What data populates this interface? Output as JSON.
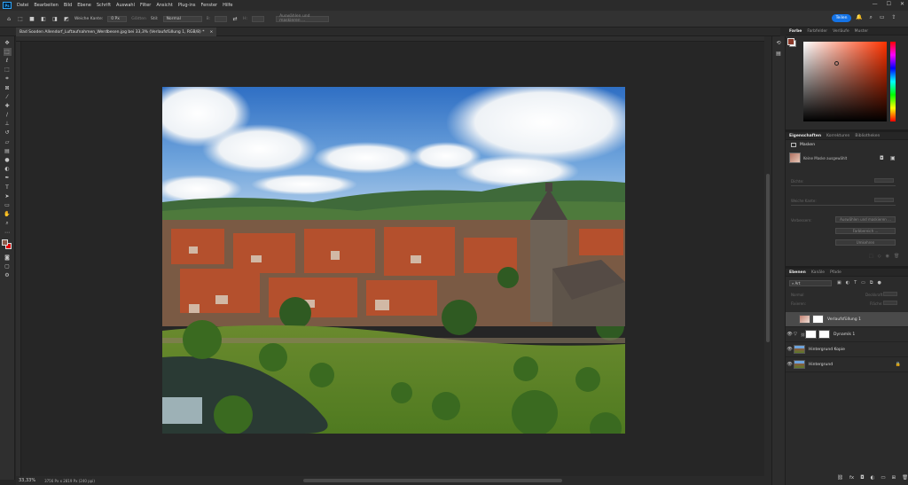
{
  "app": {
    "logo": "Ps"
  },
  "menu": [
    "Datei",
    "Bearbeiten",
    "Bild",
    "Ebene",
    "Schrift",
    "Auswahl",
    "Filter",
    "Ansicht",
    "Plug-ins",
    "Fenster",
    "Hilfe"
  ],
  "window_controls": {
    "minimize": "—",
    "maximize": "☐",
    "close": "✕"
  },
  "options": {
    "feather_label": "Weiche Kante:",
    "feather_value": "0 Px",
    "smooth_label": "Glätten",
    "style_label": "Stil:",
    "style_value": "Normal",
    "width_label": "B:",
    "height_label": "H:",
    "mask_button": "Auswählen und maskieren ..."
  },
  "share_label": "Teilen",
  "document": {
    "tab_title": "Bad Sooden Allendorf_Luftaufnahmen_Werdbesen.jpg bei 33,3% (Verlaufsfüllung 1, RGB/8) *",
    "close": "×"
  },
  "status": {
    "zoom": "33,33%",
    "info": "3756 Px x 2819 Px (240 ppi)"
  },
  "color_panel": {
    "tabs": [
      "Farbe",
      "Farbfelder",
      "Verläufe",
      "Muster"
    ],
    "active": 0,
    "hue_color": "#ff3300",
    "fg_color": "#8b3a2a",
    "bg_color": "#ffffff"
  },
  "properties_panel": {
    "tabs": [
      "Eigenschaften",
      "Korrekturen",
      "Bibliotheken"
    ],
    "active": 0,
    "section": "Masken",
    "mask_label": "Keine Maske ausgewählt",
    "density": "Dichte:",
    "feather": "Weiche Kante:",
    "refine": "Verbessern:",
    "buttons": [
      "Auswählen und maskieren ...",
      "Farbbereich ...",
      "Umkehren"
    ]
  },
  "layers_panel": {
    "tabs": [
      "Ebenen",
      "Kanäle",
      "Pfade"
    ],
    "active": 0,
    "filter": "Art",
    "blend_mode": "Normal",
    "opacity_label": "Deckkraft:",
    "lock_label": "Fixieren:",
    "fill_label": "Fläche:",
    "layers": [
      {
        "name": "Verlaufsfüllung 1",
        "visible": false,
        "selected": true,
        "type": "gradient"
      },
      {
        "name": "Dynamik 1",
        "visible": true,
        "selected": false,
        "type": "adjust"
      },
      {
        "name": "Hintergrund Kopie",
        "visible": true,
        "selected": false,
        "type": "photo"
      },
      {
        "name": "Hintergrund",
        "visible": true,
        "selected": false,
        "type": "photo",
        "locked": true
      }
    ]
  }
}
